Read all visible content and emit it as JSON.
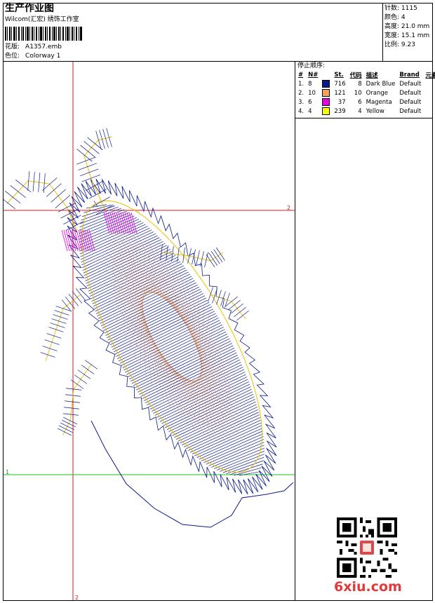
{
  "header": {
    "title": "生产作业图",
    "company": "Wilcom(汇宏) 绣饰工作室",
    "design_label": "花版:",
    "design_value": "A1357.emb",
    "colorway_label": "色位:",
    "colorway_value": "Colorway 1"
  },
  "stats": {
    "stitches": "针数: 1115",
    "colors": "颜色: 4",
    "height": "高度: 21.0 mm",
    "width": "宽度: 15.1 mm",
    "scale": "比例: 9.23"
  },
  "stop_sequence": {
    "title": "停止顺序:",
    "columns": [
      "#",
      "N#",
      "St.",
      "代码",
      "描述",
      "Brand",
      "元素"
    ],
    "rows": [
      {
        "idx": "1.",
        "n": "8",
        "color": "#0a1a8c",
        "st": "716",
        "code": "8",
        "desc": "Dark Blue",
        "brand": "Default"
      },
      {
        "idx": "2.",
        "n": "10",
        "color": "#f5a25a",
        "st": "121",
        "code": "10",
        "desc": "Orange",
        "brand": "Default"
      },
      {
        "idx": "3.",
        "n": "6",
        "color": "#e600e6",
        "st": "37",
        "code": "6",
        "desc": "Magenta",
        "brand": "Default"
      },
      {
        "idx": "4.",
        "n": "4",
        "color": "#ffff00",
        "st": "239",
        "code": "4",
        "desc": "Yellow",
        "brand": "Default"
      }
    ]
  },
  "axes": {
    "label_top_right": "2",
    "label_left": "1",
    "label_bottom": "2"
  },
  "watermark": {
    "brand": "6xiu.com"
  }
}
